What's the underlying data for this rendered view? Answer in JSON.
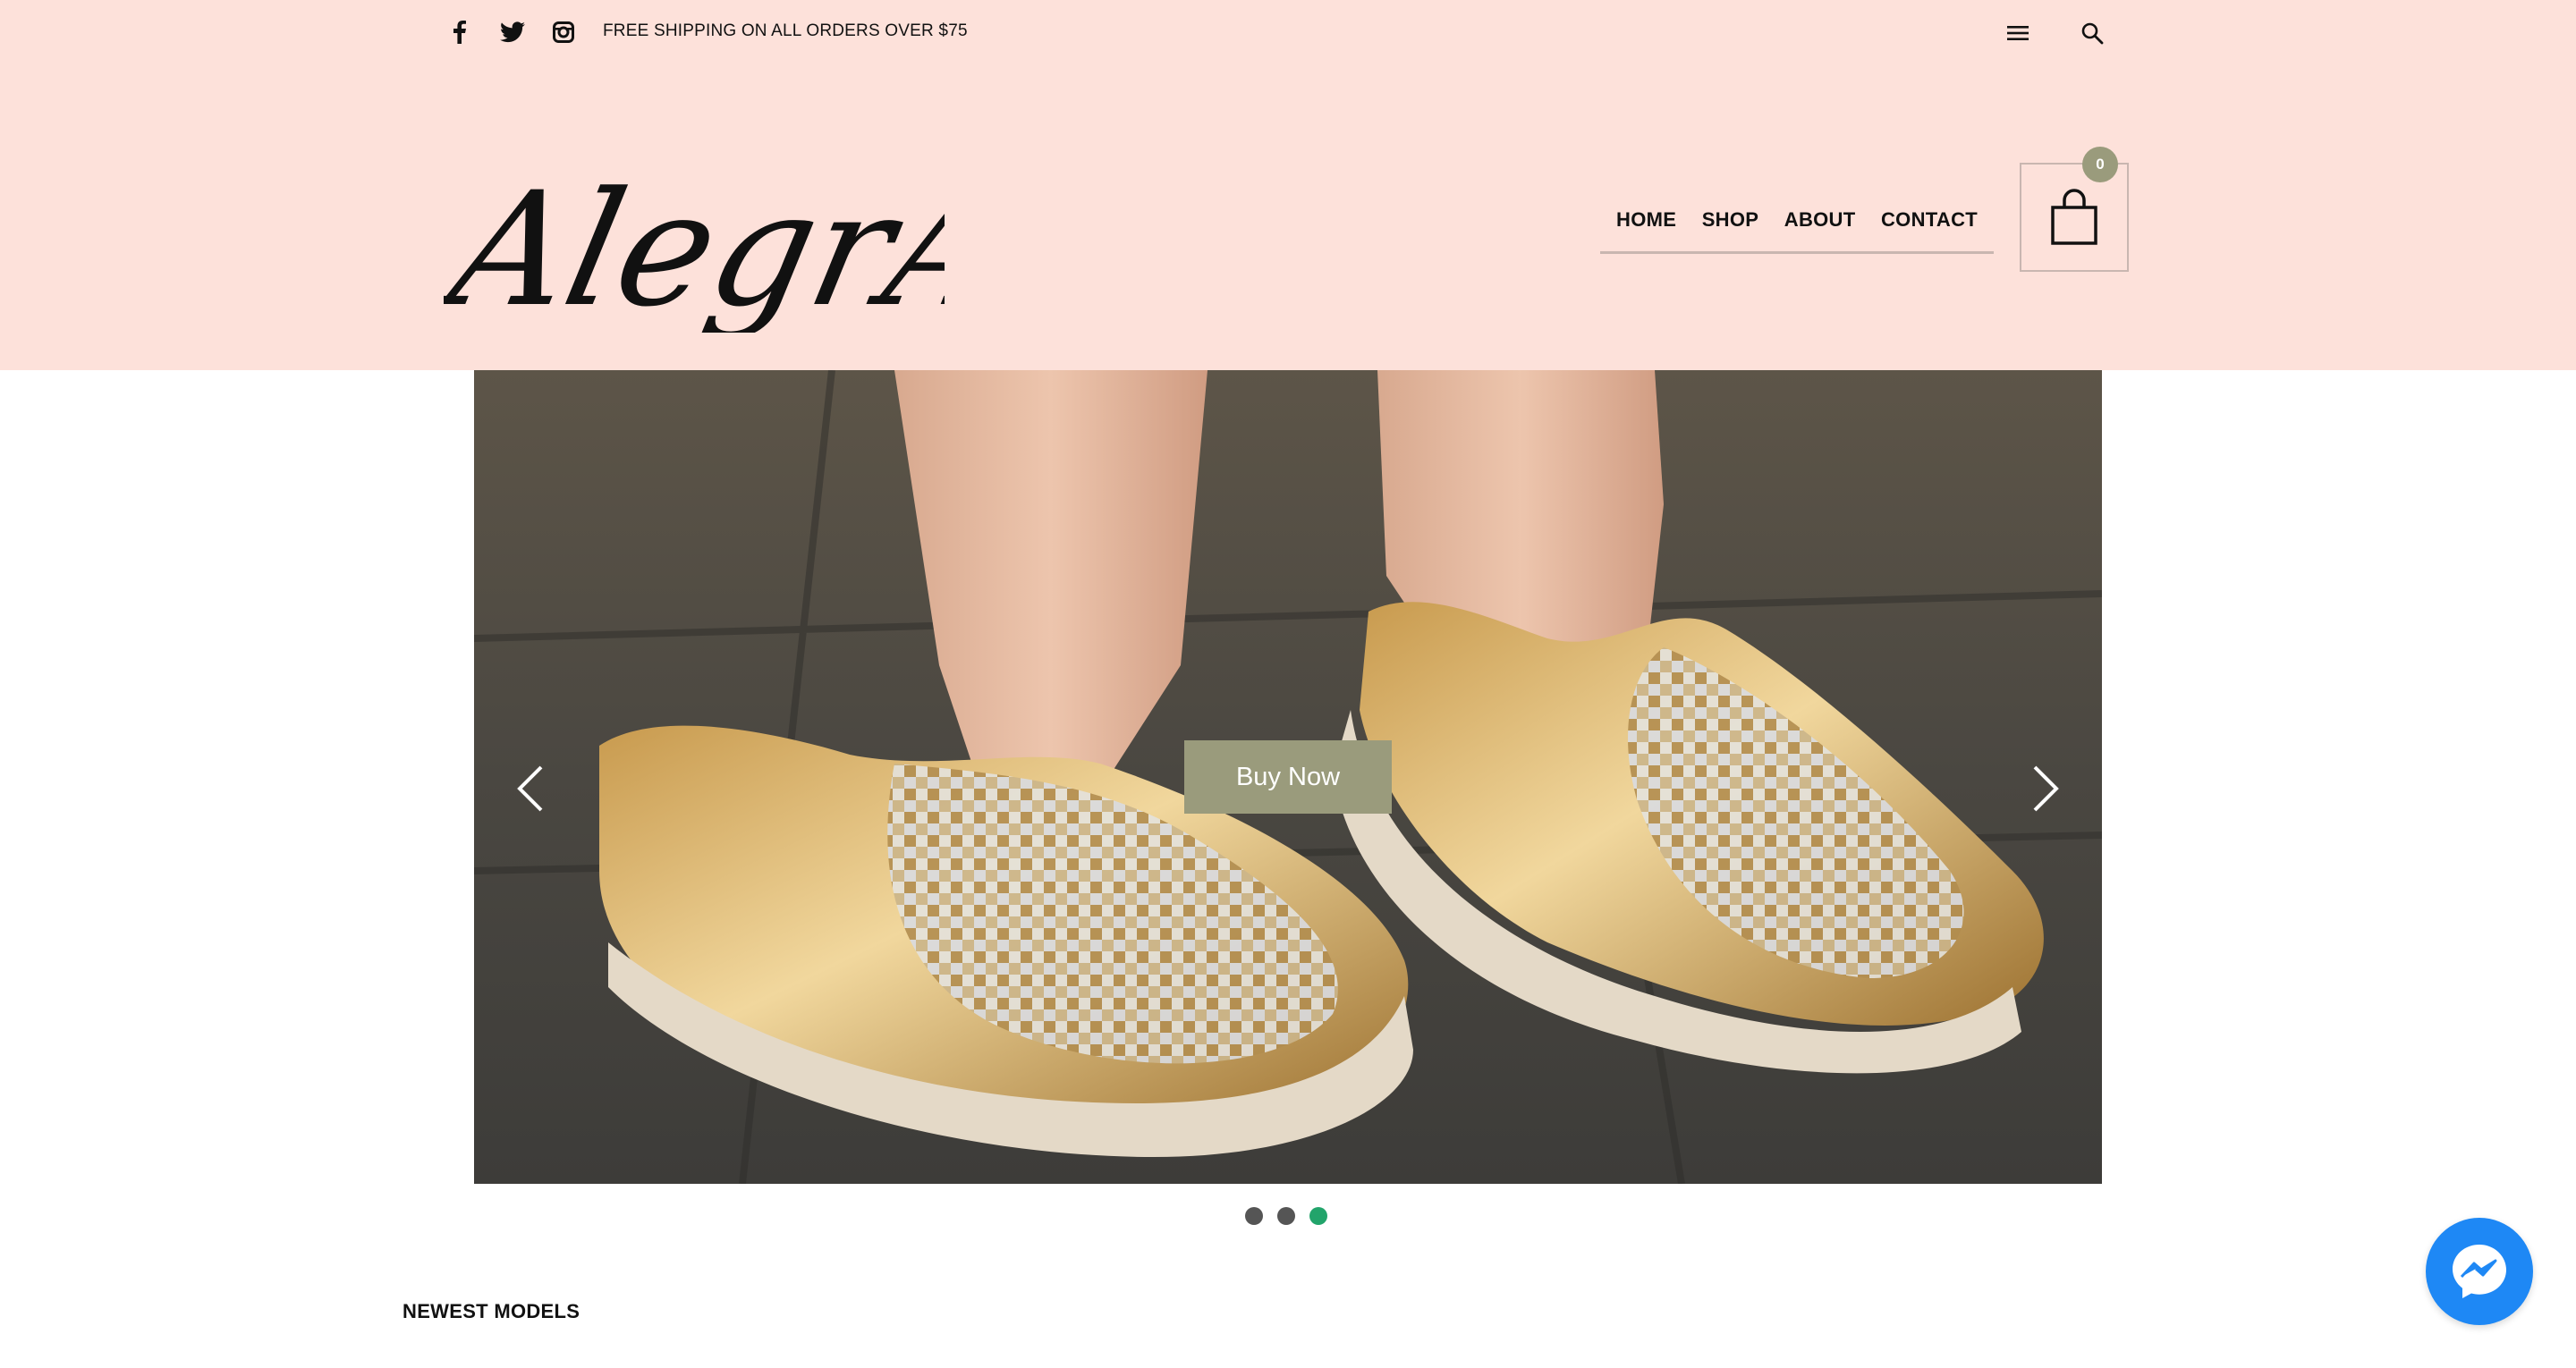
{
  "topbar": {
    "social_icons": [
      "facebook-icon",
      "twitter-icon",
      "instagram-icon"
    ],
    "shipping_text": "FREE SHIPPING ON ALL ORDERS OVER $75",
    "right_icons": [
      "menu-icon",
      "search-icon"
    ]
  },
  "logo": {
    "text": "AlegrArte"
  },
  "nav": {
    "items": [
      {
        "label": "HOME"
      },
      {
        "label": "SHOP"
      },
      {
        "label": "ABOUT"
      },
      {
        "label": "CONTACT"
      }
    ]
  },
  "cart": {
    "count": "0",
    "icon": "shopping-bag-icon"
  },
  "hero": {
    "button_label": "Buy Now",
    "prev_icon": "chevron-left-icon",
    "next_icon": "chevron-right-icon",
    "slide_count": 3,
    "active_slide": 3
  },
  "sections": {
    "newest_title": "NEWEST MODELS"
  },
  "messenger": {
    "icon": "messenger-icon"
  },
  "colors": {
    "header_bg": "#fde1da",
    "accent": "#9a9b7c",
    "active_dot": "#22a46b",
    "messenger": "#1e88f5"
  }
}
